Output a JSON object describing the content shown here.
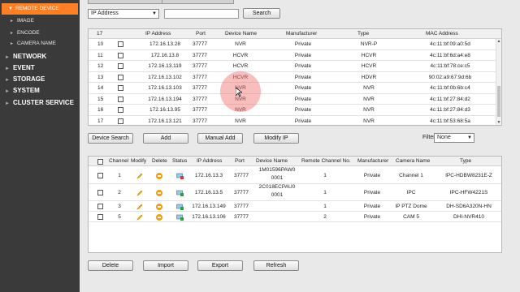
{
  "sidebar": {
    "active": "REMOTE DEVICE",
    "subitems": [
      "IMAGE",
      "ENCODE",
      "CAMERA NAME"
    ],
    "main_items": [
      "NETWORK",
      "EVENT",
      "STORAGE",
      "SYSTEM",
      "CLUSTER SERVICE"
    ],
    "accent_color": "#ff7f24"
  },
  "search_bar": {
    "type_value": "IP Address",
    "search_label": "Search"
  },
  "search_table": {
    "headers": [
      "17",
      "IP Address",
      "Port",
      "Device Name",
      "Manufacturer",
      "Type",
      "MAC Address"
    ],
    "rows": [
      {
        "no": "10",
        "ip": "172.16.13.28",
        "port": "37777",
        "name": "NVR",
        "manufacturer": "Private",
        "type": "NVR-P",
        "mac": "4c:11:bf:09:a0:5d"
      },
      {
        "no": "11",
        "ip": "172.16.13.8",
        "port": "37777",
        "name": "HCVR",
        "manufacturer": "Private",
        "type": "HCVR",
        "mac": "4c:11:bf:6d:a4:e8"
      },
      {
        "no": "12",
        "ip": "172.16.13.119",
        "port": "37777",
        "name": "HCVR",
        "manufacturer": "Private",
        "type": "HCVR",
        "mac": "4c:11:bf:78:ce:c5"
      },
      {
        "no": "13",
        "ip": "172.16.13.102",
        "port": "37777",
        "name": "HCVR",
        "manufacturer": "Private",
        "type": "HDVR",
        "mac": "90:02:a9:67:9d:6b"
      },
      {
        "no": "14",
        "ip": "172.16.13.103",
        "port": "37777",
        "name": "NVR",
        "manufacturer": "Private",
        "type": "NVR",
        "mac": "4c:11:bf:0b:6b:c4"
      },
      {
        "no": "15",
        "ip": "172.16.13.194",
        "port": "37777",
        "name": "NVR",
        "manufacturer": "Private",
        "type": "NVR",
        "mac": "4c:11:bf:27:84:d2"
      },
      {
        "no": "16",
        "ip": "172.16.13.95",
        "port": "37777",
        "name": "NVR",
        "manufacturer": "Private",
        "type": "NVR",
        "mac": "4c:11:bf:27:84:d3"
      },
      {
        "no": "17",
        "ip": "172.16.13.121",
        "port": "37777",
        "name": "NVR",
        "manufacturer": "Private",
        "type": "NVR",
        "mac": "4c:11:bf:53:68:5a"
      }
    ]
  },
  "actions": {
    "device_search": "Device Search",
    "add": "Add",
    "manual_add": "Manual Add",
    "modify_ip": "Modify IP",
    "filter_label": "Filter",
    "filter_value": "None"
  },
  "added_table": {
    "headers": [
      "Channel",
      "Modify",
      "Delete",
      "Status",
      "IP Address",
      "Port",
      "Device Name",
      "Remote Channel No.",
      "Manufacturer",
      "Camera Name",
      "Type"
    ],
    "rows": [
      {
        "channel": "1",
        "ip": "172.16.13.3",
        "port": "37777",
        "name1": "1M01596PAW0",
        "name2": "0001",
        "remote": "1",
        "manufacturer": "Private",
        "camera": "Channel 1",
        "type": "IPC-HDBW8231E-Z"
      },
      {
        "channel": "2",
        "ip": "172.16.13.5",
        "port": "37777",
        "name1": "2C018ECPAU0",
        "name2": "0001",
        "remote": "1",
        "manufacturer": "Private",
        "camera": "IPC",
        "type": "IPC-HFW4221S"
      },
      {
        "channel": "3",
        "ip": "172.16.13.149",
        "port": "37777",
        "name1": "",
        "name2": "",
        "remote": "1",
        "manufacturer": "Private",
        "camera": "IP PTZ Dome",
        "type": "DH-SD6A320N-HN"
      },
      {
        "channel": "5",
        "ip": "172.16.13.106",
        "port": "37777",
        "name1": "",
        "name2": "",
        "remote": "2",
        "manufacturer": "Private",
        "camera": "CAM 5",
        "type": "DHI-NVR410"
      }
    ]
  },
  "bottom": {
    "delete": "Delete",
    "import": "Import",
    "export": "Export",
    "refresh": "Refresh"
  }
}
